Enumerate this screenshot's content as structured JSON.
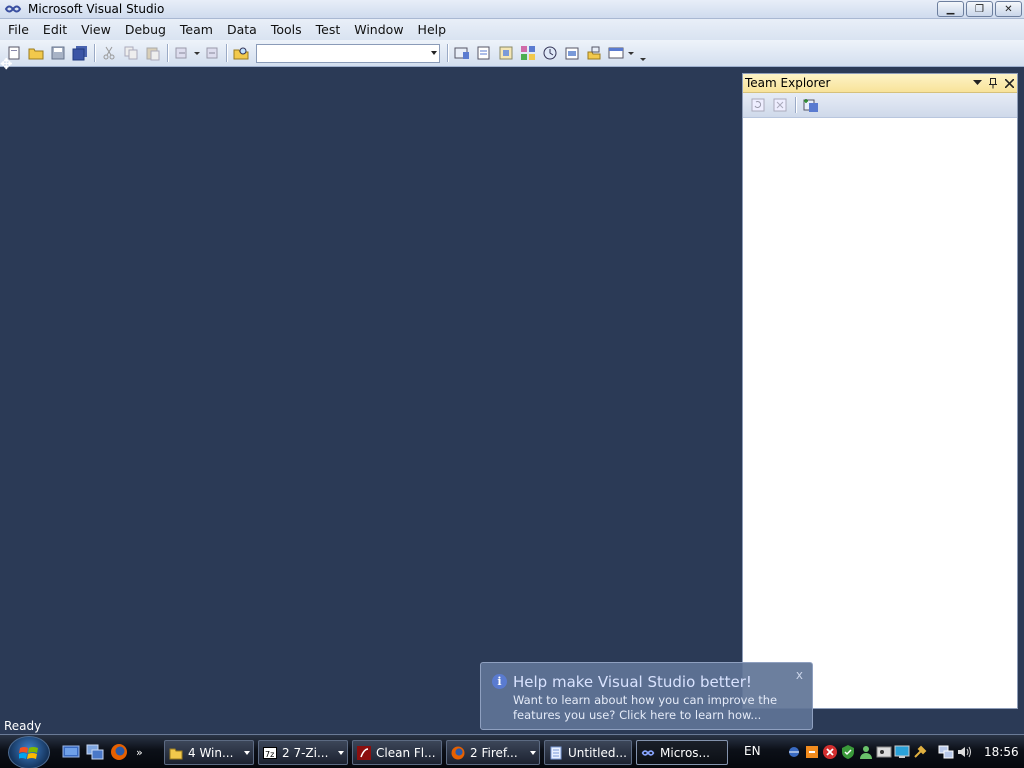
{
  "window": {
    "title": "Microsoft Visual Studio",
    "icon": "visual-studio-icon"
  },
  "menu": [
    "File",
    "Edit",
    "View",
    "Debug",
    "Team",
    "Data",
    "Tools",
    "Test",
    "Window",
    "Help"
  ],
  "toolbar": {
    "combo_value": "",
    "icons": [
      "new-project-icon",
      "open-file-icon",
      "save-icon",
      "save-all-icon",
      "cut-icon",
      "copy-icon",
      "paste-icon",
      "undo-icon",
      "redo-icon",
      "find-in-files-icon",
      "solution-explorer-icon",
      "properties-icon",
      "object-browser-icon",
      "class-view-icon",
      "start-page-icon",
      "toolbox-icon",
      "team-explorer-icon",
      "other-windows-icon"
    ]
  },
  "team_explorer": {
    "title": "Team Explorer",
    "toolbar_icons": [
      "refresh-icon",
      "stop-icon",
      "add-project-icon"
    ]
  },
  "status": {
    "text": "Ready"
  },
  "balloon": {
    "title": "Help make Visual Studio better!",
    "text": "Want to learn about how you can improve the features you use? Click here to learn how...",
    "close": "x"
  },
  "taskbar": {
    "quick_launch_more": "»",
    "tasks": [
      {
        "label": "4 Win...",
        "icon": "folder-icon"
      },
      {
        "label": "2 7-Zi...",
        "icon": "7zip-icon"
      },
      {
        "label": "Clean Fl...",
        "icon": "flash-icon"
      },
      {
        "label": "2 Firef...",
        "icon": "firefox-icon"
      },
      {
        "label": "Untitled...",
        "icon": "notepad-icon"
      },
      {
        "label": "Micros...",
        "icon": "visual-studio-icon"
      }
    ],
    "language": "EN",
    "clock": "18:56"
  }
}
